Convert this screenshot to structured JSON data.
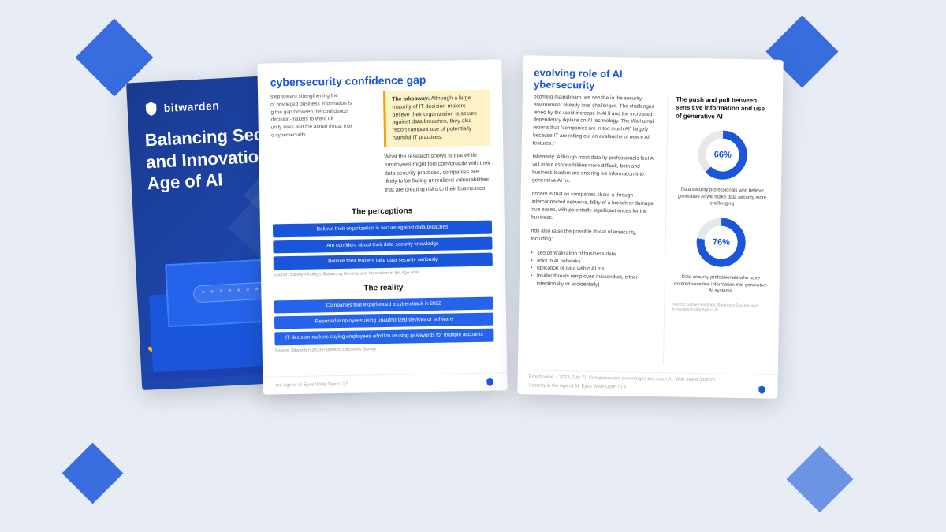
{
  "scene": {
    "bg_color": "#e8edf5"
  },
  "cover": {
    "logo_text": "bitwarden",
    "title": "Balancing Security and Innovation in the Age of AI",
    "password_dots": "* * * * * * * * *"
  },
  "middle_page": {
    "section_title": "cybersecurity confidence gap",
    "takeaway_title": "The takeaway:",
    "takeaway_text": "Although a large majority of IT decision-makers believe their organization is secure against data breaches, they also report rampant use of potentially harmful IT practices.",
    "body_text": "What the research shows is that while employees might feel comfortable with their data security practices, companies are likely to be facing unrealized vulnerabilities that are creating risks to their businesses.",
    "perceptions_title": "The perceptions",
    "bars": [
      "Believe their organization is secure against data breaches",
      "Are confident about their data security knowledge",
      "Believe their leaders take data security seriously"
    ],
    "source1": "Source: Survey Findings: Balancing Security and Innovation in the Age of AI",
    "reality_title": "The reality",
    "reality_bars": [
      "Companies that experienced a cyberattack in 2022",
      "Reported employees using unauthorized devices or software",
      "IT decision-makers saying employees admit to reusing passwords for multiple accounts"
    ],
    "source2": "Source: Bitwarden 2023 Password Decisions Survey",
    "footer_text": "the Age of AI Eyes Wide Open? | 3"
  },
  "front_page": {
    "section_title": "evolving role of AI",
    "section_subtitle": "ybersecurity",
    "body_text1": "ocoming mainstream, we see the in the security environment already ious challenges. The challenges tened by the rapid increase in AI ll and the increased dependency rkplace on AI technology. The Wall urnal reports that \"companies are in too much AI\" largely because IT are rolling out an avalanche of new e AI features.\"",
    "takeaway_text": "takeaway: Although most data ity professionals feel AI will make esponsibilities more difficult, both and business leaders are entering ive information into generative AI ns.",
    "concern_text": "oncern is that as companies share a through interconnected networks, bility of a breach or damage due eases, with potentially significant ences for the business.",
    "nds_text": "nds also raise the possible threat of ersecurity, including:",
    "bullets": [
      "sed centralization of business data",
      "links in AI networks",
      "uplication of data within AI ms",
      "Insider threats (employee misconduct, either intentionally or accidentally)"
    ],
    "right_title": "The push and pull between sensitive information and use of generative AI",
    "chart1_pct": "66%",
    "chart1_caption": "Data security professionals who believe generative AI will make data security more challenging",
    "chart2_pct": "76%",
    "chart2_caption": "Data security professionals who have entered sensitive information into generative AI systems",
    "source": "Source: Survey Findings: Balancing Security and Innovation in the Age of AI",
    "footer_text": "Security in the Age of AI: Eyes Wide Open? | 4",
    "footnote": "Brandywine. ( 2023, July 7). Companies are drowning in too much AI. Wall Street Journal."
  }
}
